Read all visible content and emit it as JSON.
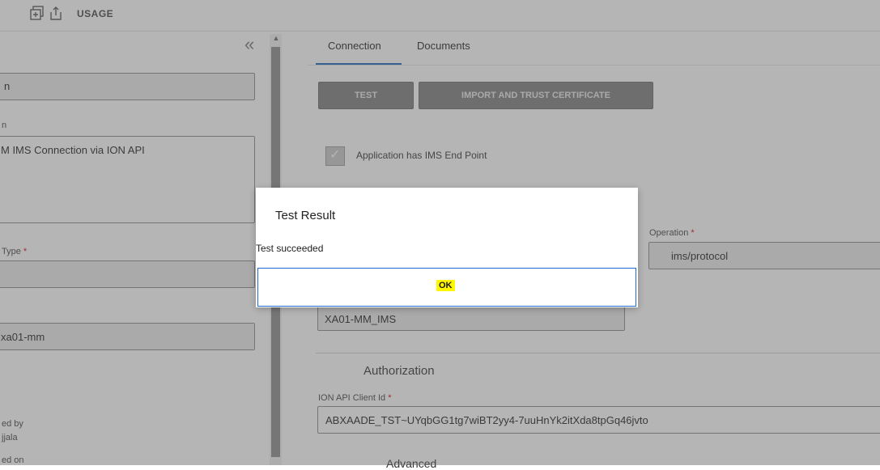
{
  "toolbar": {
    "usage_label": "USAGE"
  },
  "left": {
    "field1_value": "n",
    "description_label": "n",
    "description_value": "M IMS Connection via ION API",
    "type_label": "Type",
    "type_value": "",
    "field3_value": "xa01-mm",
    "created_by_label": "ed by",
    "created_by_value": "jjala",
    "created_on_label": "ed on"
  },
  "tabs": [
    {
      "label": "Connection"
    },
    {
      "label": "Documents"
    }
  ],
  "buttons": {
    "test": "TEST",
    "import": "IMPORT AND TRUST CERTIFICATE"
  },
  "checkbox": {
    "label": "Application has IMS End Point",
    "checked": true
  },
  "operation": {
    "label": "Operation",
    "value": "ims/protocol"
  },
  "logical_id_value": "XA01-MM_IMS",
  "authorization": {
    "heading": "Authorization",
    "client_id_label": "ION API Client Id",
    "client_id_value": "ABXAADE_TST~UYqbGG1tg7wiBT2yy4-7uuHnYk2itXda8tpGq46jvto"
  },
  "advanced_partial": "Advanced",
  "required_marker": "*",
  "dialog": {
    "title": "Test Result",
    "message": "Test succeeded",
    "ok": "OK"
  },
  "colors": {
    "accent": "#1565c0",
    "highlight": "#fff700",
    "required": "#e0001b"
  }
}
